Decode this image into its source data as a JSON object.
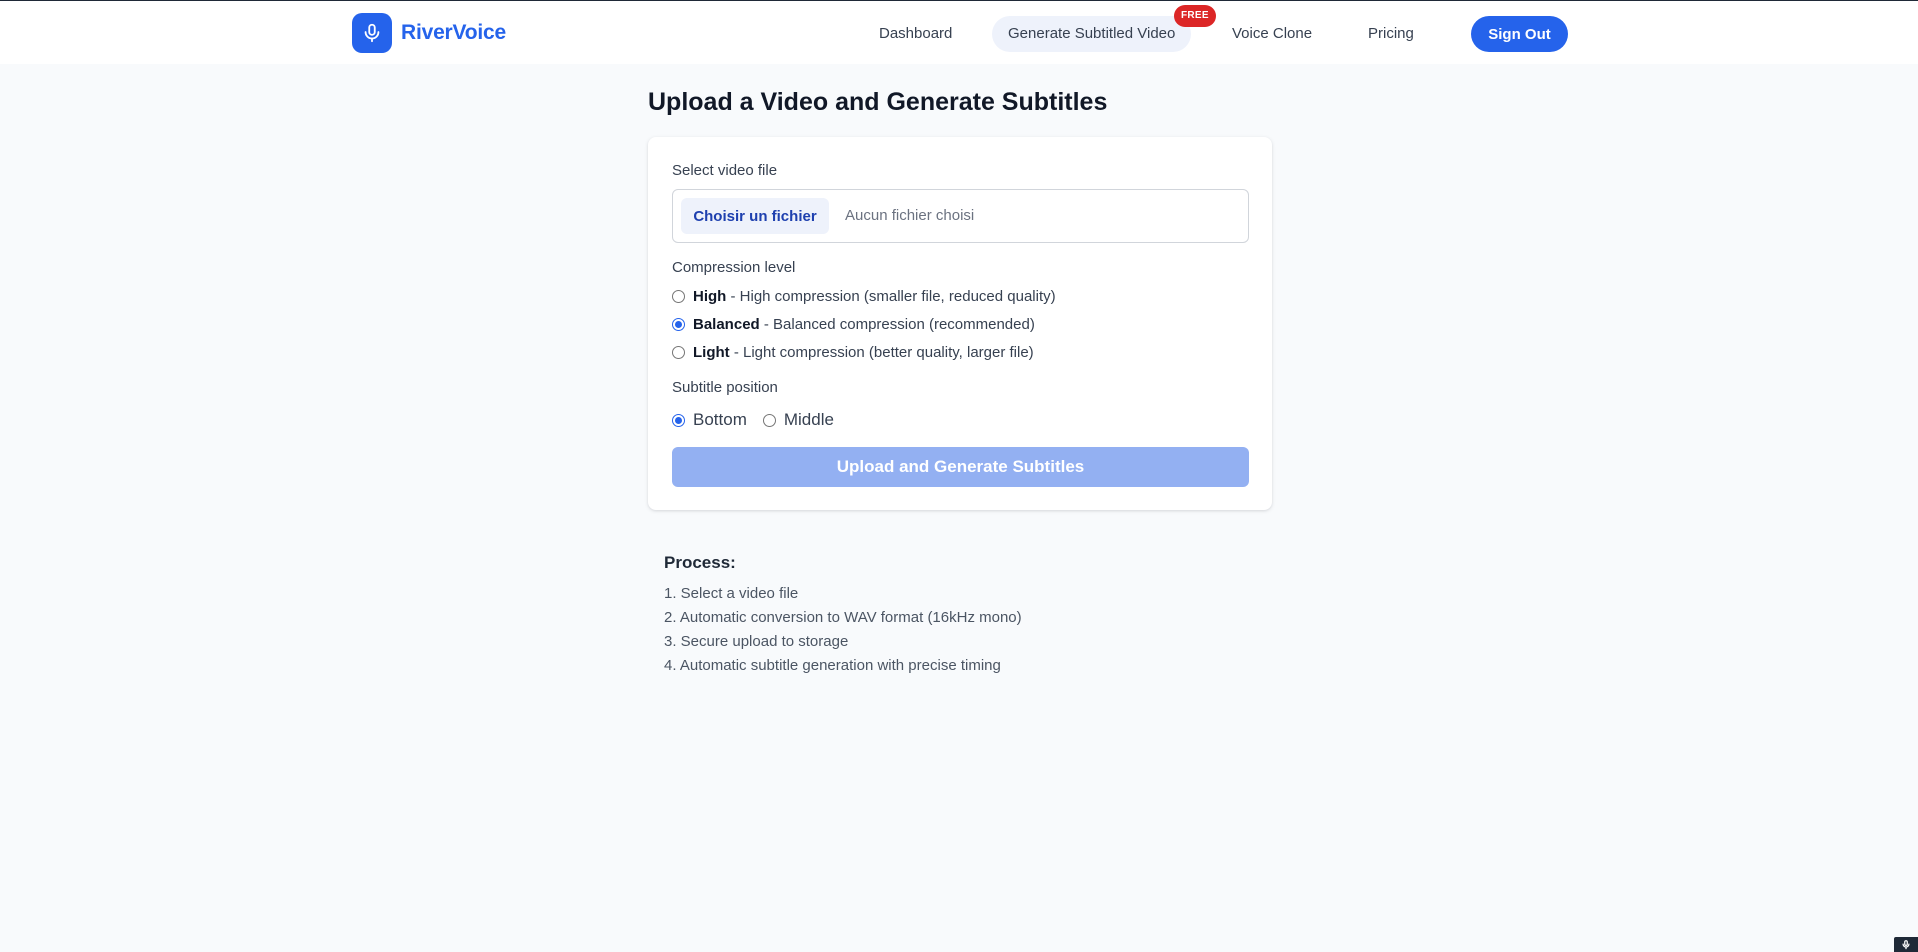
{
  "brand": {
    "name": "RiverVoice",
    "icon": "microphone-icon",
    "color": "#2563eb"
  },
  "nav": {
    "items": [
      {
        "label": "Dashboard"
      },
      {
        "label": "Generate Subtitled Video",
        "active": true,
        "badge": "FREE"
      },
      {
        "label": "Voice Clone"
      },
      {
        "label": "Pricing"
      }
    ],
    "sign_out": "Sign Out"
  },
  "page": {
    "title": "Upload a Video and Generate Subtitles"
  },
  "form": {
    "file_label": "Select video file",
    "file_button": "Choisir un fichier",
    "file_status": "Aucun fichier choisi",
    "compression_label": "Compression level",
    "compression_options": [
      {
        "name": "High",
        "description": "- High compression (smaller file, reduced quality)",
        "selected": false
      },
      {
        "name": "Balanced",
        "description": "- Balanced compression (recommended)",
        "selected": true
      },
      {
        "name": "Light",
        "description": "- Light compression (better quality, larger file)",
        "selected": false
      }
    ],
    "position_label": "Subtitle position",
    "position_options": [
      {
        "label": "Bottom",
        "selected": true
      },
      {
        "label": "Middle",
        "selected": false
      }
    ],
    "submit": "Upload and Generate Subtitles"
  },
  "process": {
    "title": "Process:",
    "steps": [
      "1. Select a video file",
      "2. Automatic conversion to WAV format (16kHz mono)",
      "3. Secure upload to storage",
      "4. Automatic subtitle generation with precise timing"
    ]
  },
  "colors": {
    "accent": "#2563eb",
    "badge": "#dc2626",
    "button_disabled": "#93b0f2",
    "background": "#f8fafc"
  }
}
